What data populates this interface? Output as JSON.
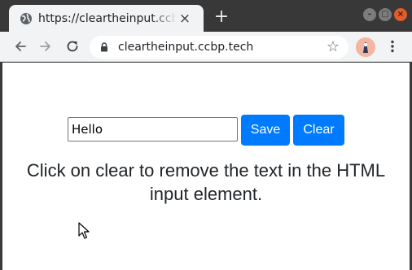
{
  "browser": {
    "tab": {
      "title": "https://cleartheinput.ccbp.tech",
      "close_glyph": "×",
      "icon": "globe-icon"
    },
    "new_tab_glyph": "+",
    "window_controls": {
      "minimize_glyph": "–",
      "maximize_glyph": "□",
      "close_glyph": "×"
    },
    "toolbar": {
      "back_icon": "arrow-left-icon",
      "forward_icon": "arrow-right-icon",
      "reload_icon": "reload-icon",
      "lock_icon": "lock-icon",
      "url": "cleartheinput.ccbp.tech",
      "star_glyph": "☆",
      "menu_icon": "vertical-dots-icon"
    }
  },
  "page": {
    "input": {
      "value": "Hello"
    },
    "buttons": {
      "save_label": "Save",
      "clear_label": "Clear"
    },
    "message": "Click on clear to remove the text in the HTML input element."
  },
  "colors": {
    "button_bg": "#007bff",
    "button_text": "#ffffff",
    "titlebar_bg": "#383838",
    "toolbar_bg": "#f1f3f4",
    "page_bg": "#ffffff"
  }
}
